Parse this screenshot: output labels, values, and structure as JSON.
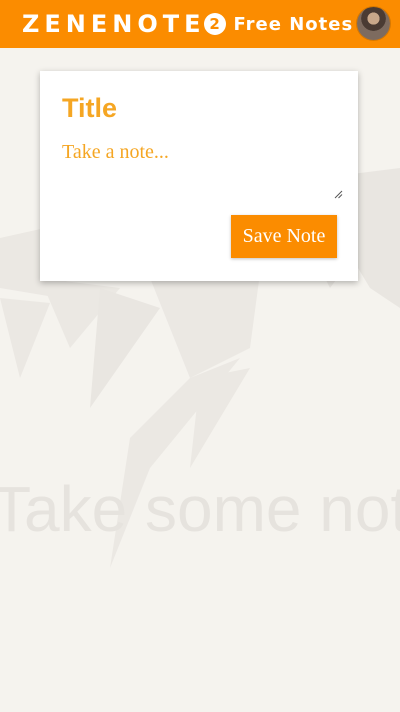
{
  "header": {
    "logo_text": "ZENENOTE",
    "logo_badge": "2",
    "subtitle": "Free Notes",
    "avatar_icon": "user-avatar-icon"
  },
  "colors": {
    "accent": "#fb8c00",
    "accent_text": "#f5a623",
    "background": "#f5f3ee",
    "watermark": "#e6e3de"
  },
  "note_form": {
    "title_placeholder": "Title",
    "title_value": "",
    "body_placeholder": "Take a note...",
    "body_value": "",
    "save_label": "Save Note"
  },
  "background": {
    "watermark_text": "Take some notes",
    "illustration": "low-poly-bird"
  }
}
